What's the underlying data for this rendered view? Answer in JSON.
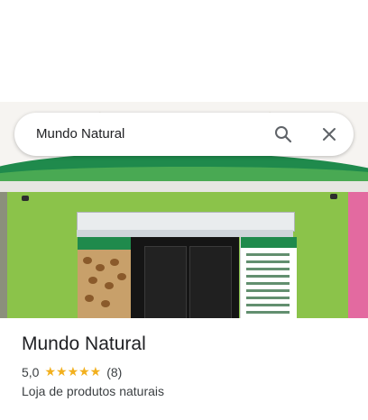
{
  "search": {
    "query": "Mundo Natural",
    "search_icon": "search-icon",
    "close_icon": "close-icon"
  },
  "place": {
    "title": "Mundo Natural",
    "rating": "5,0",
    "stars_text": "★★★★★",
    "review_count": "(8)",
    "category": "Loja de produtos naturais"
  },
  "colors": {
    "star": "#f2b01e",
    "sign_green": "#1f8a4c",
    "wall_green": "#8bc34a"
  }
}
